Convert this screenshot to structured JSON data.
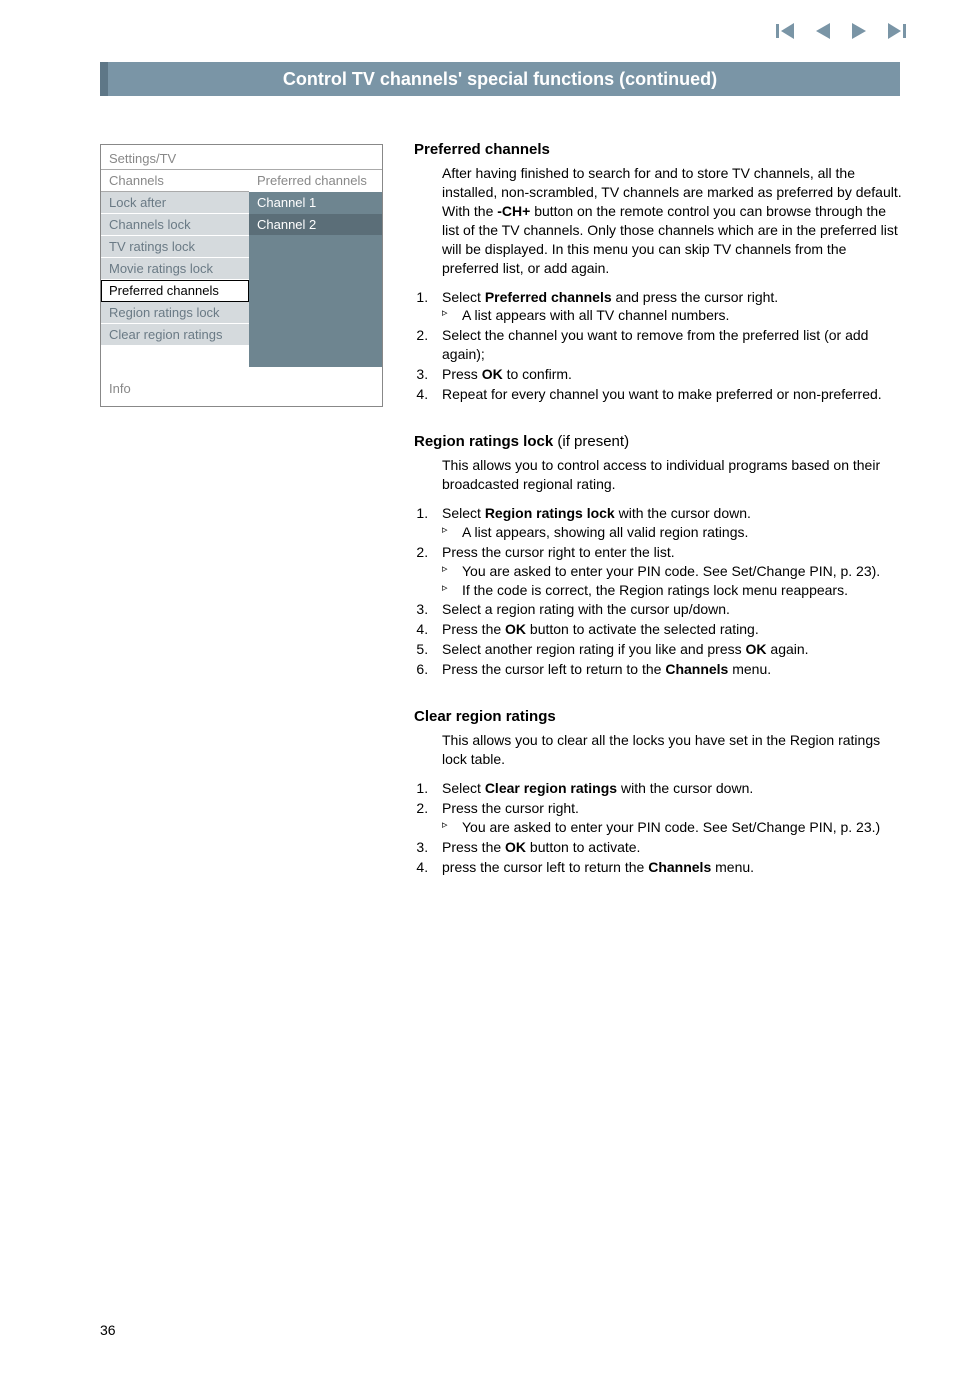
{
  "header": {
    "title": "Control TV channels' special functions  (continued)"
  },
  "menu": {
    "breadcrumb": "Settings/TV",
    "left_title": "Channels",
    "right_title": "Preferred channels",
    "items": [
      {
        "label": "Lock after",
        "value": "Channel 1",
        "shade": true
      },
      {
        "label": "Channels lock",
        "value": "Channel 2",
        "shade": true,
        "dark": true
      },
      {
        "label": "TV ratings lock",
        "value": "",
        "shade": true
      },
      {
        "label": "Movie ratings lock",
        "value": "",
        "shade": true
      },
      {
        "label": "Preferred channels",
        "value": "",
        "shade": true,
        "selected": true
      },
      {
        "label": "Region ratings lock",
        "value": "",
        "shade": true
      },
      {
        "label": "Clear region ratings",
        "value": "",
        "shade": true
      },
      {
        "label": "",
        "value": "",
        "shade": true
      }
    ],
    "info": "Info"
  },
  "sections": {
    "preferred": {
      "title": "Preferred channels",
      "desc_a": "After having finished to search for and to store TV channels, all the installed, non-scrambled, TV channels are marked as preferred by default.",
      "desc_b_pre": "With the ",
      "desc_b_bold": "-CH+",
      "desc_b_post": " button on the remote control you can browse through the list of the TV channels. Only those channels which are in the preferred list will be displayed. In this menu you can skip TV channels from the preferred list, or add again.",
      "s1_pre": "Select ",
      "s1_bold": "Preferred channels",
      "s1_post": " and press the cursor right.",
      "s1_sub": "A list appears with all TV channel numbers.",
      "s2": "Select the channel you want to remove from the preferred list (or add again);",
      "s3_pre": "Press ",
      "s3_bold": "OK",
      "s3_post": " to confirm.",
      "s4": "Repeat for every channel you want to make preferred or non-preferred."
    },
    "region": {
      "title_main": "Region ratings lock",
      "title_note": "  (if present)",
      "desc": "This allows you to control access to individual programs based on their broadcasted regional rating.",
      "s1_pre": "Select ",
      "s1_bold": "Region ratings lock",
      "s1_post": " with the cursor down.",
      "s1_sub": "A list appears, showing all valid region ratings.",
      "s2": "Press the cursor right to enter the list.",
      "s2_sub1": "You are asked to enter your PIN code. See Set/Change PIN, p. 23).",
      "s2_sub2": "If the code is correct, the Region ratings lock menu reappears.",
      "s3": "Select a region rating with the cursor up/down.",
      "s4_pre": "Press the ",
      "s4_bold": "OK",
      "s4_post": " button to activate the selected rating.",
      "s5_pre": "Select another region rating if you like and press ",
      "s5_bold": "OK",
      "s5_post": " again.",
      "s6_pre": "Press the cursor left to return to the ",
      "s6_bold": "Channels",
      "s6_post": " menu."
    },
    "clear": {
      "title": "Clear region ratings",
      "desc": "This allows you to clear all the locks you have set in the Region ratings lock table.",
      "s1_pre": "Select ",
      "s1_bold": "Clear region ratings",
      "s1_post": " with the cursor down.",
      "s2": "Press the cursor right.",
      "s2_sub": "You are asked to enter your PIN code. See Set/Change PIN, p. 23.)",
      "s3_pre": "Press the ",
      "s3_bold": "OK",
      "s3_post": " button to activate.",
      "s4_pre": "press the cursor left to return the ",
      "s4_bold": "Channels",
      "s4_post": " menu."
    }
  },
  "page_number": "36"
}
